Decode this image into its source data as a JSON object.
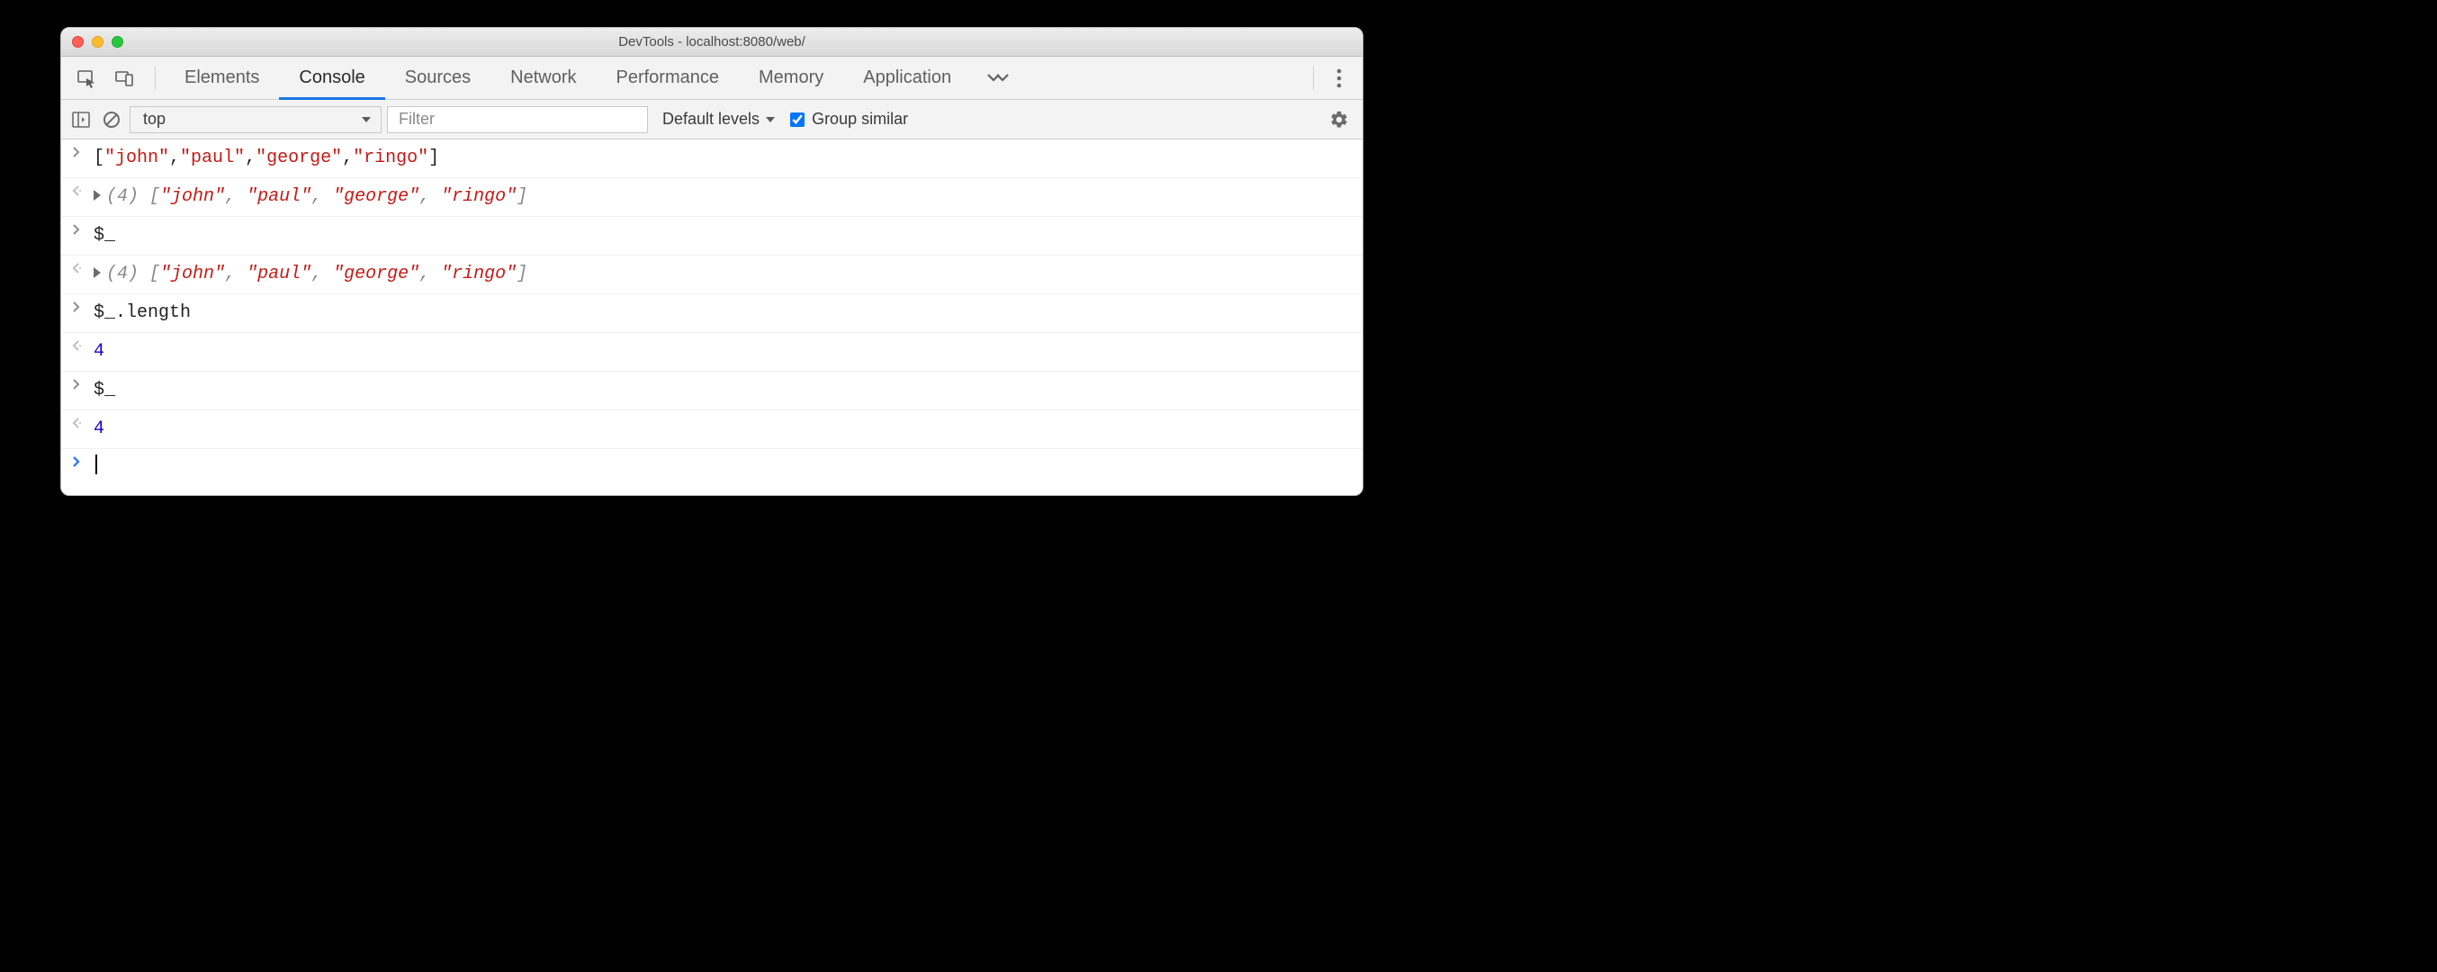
{
  "window": {
    "title": "DevTools - localhost:8080/web/"
  },
  "tabs": {
    "items": [
      "Elements",
      "Console",
      "Sources",
      "Network",
      "Performance",
      "Memory",
      "Application"
    ],
    "active": "Console"
  },
  "toolbar": {
    "context": "top",
    "filter_placeholder": "Filter",
    "levels_label": "Default levels",
    "group_similar_label": "Group similar",
    "group_similar_checked": true
  },
  "console": {
    "rows": [
      {
        "kind": "input",
        "tokens": [
          {
            "t": "punct",
            "v": "["
          },
          {
            "t": "string",
            "v": "\"john\""
          },
          {
            "t": "punct",
            "v": ","
          },
          {
            "t": "string",
            "v": "\"paul\""
          },
          {
            "t": "punct",
            "v": ","
          },
          {
            "t": "string",
            "v": "\"george\""
          },
          {
            "t": "punct",
            "v": ","
          },
          {
            "t": "string",
            "v": "\"ringo\""
          },
          {
            "t": "punct",
            "v": "]"
          }
        ]
      },
      {
        "kind": "output_array",
        "len": "(4)",
        "tokens": [
          {
            "t": "punct",
            "v": "["
          },
          {
            "t": "string",
            "v": "\"john\""
          },
          {
            "t": "punct",
            "v": ", "
          },
          {
            "t": "string",
            "v": "\"paul\""
          },
          {
            "t": "punct",
            "v": ", "
          },
          {
            "t": "string",
            "v": "\"george\""
          },
          {
            "t": "punct",
            "v": ", "
          },
          {
            "t": "string",
            "v": "\"ringo\""
          },
          {
            "t": "punct",
            "v": "]"
          }
        ]
      },
      {
        "kind": "input",
        "tokens": [
          {
            "t": "plain",
            "v": "$_"
          }
        ]
      },
      {
        "kind": "output_array",
        "len": "(4)",
        "tokens": [
          {
            "t": "punct",
            "v": "["
          },
          {
            "t": "string",
            "v": "\"john\""
          },
          {
            "t": "punct",
            "v": ", "
          },
          {
            "t": "string",
            "v": "\"paul\""
          },
          {
            "t": "punct",
            "v": ", "
          },
          {
            "t": "string",
            "v": "\"george\""
          },
          {
            "t": "punct",
            "v": ", "
          },
          {
            "t": "string",
            "v": "\"ringo\""
          },
          {
            "t": "punct",
            "v": "]"
          }
        ]
      },
      {
        "kind": "input",
        "tokens": [
          {
            "t": "plain",
            "v": "$_.length"
          }
        ]
      },
      {
        "kind": "output_value",
        "tokens": [
          {
            "t": "num",
            "v": "4"
          }
        ]
      },
      {
        "kind": "input",
        "tokens": [
          {
            "t": "plain",
            "v": "$_"
          }
        ]
      },
      {
        "kind": "output_value",
        "tokens": [
          {
            "t": "num",
            "v": "4"
          }
        ]
      },
      {
        "kind": "prompt"
      }
    ]
  }
}
